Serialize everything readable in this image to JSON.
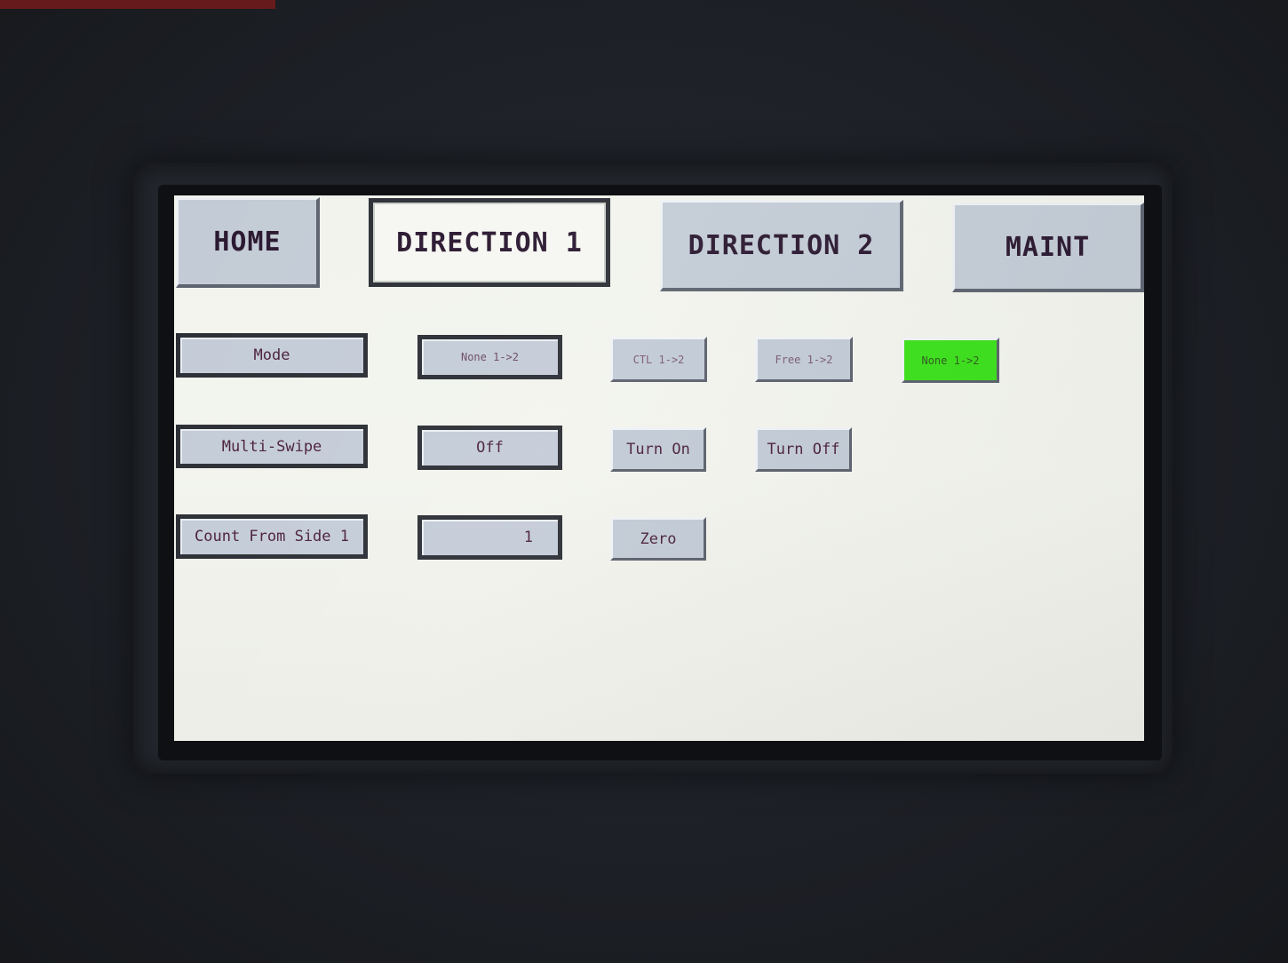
{
  "tabs": {
    "home": "HOME",
    "direction1": "DIRECTION 1",
    "direction2": "DIRECTION 2",
    "maint": "MAINT"
  },
  "rows": {
    "mode": {
      "label": "Mode",
      "value": "None 1->2",
      "options": {
        "ctl": "CTL 1->2",
        "free": "Free 1->2",
        "none": "None 1->2"
      },
      "active_color": "#3be01a"
    },
    "multi_swipe": {
      "label": "Multi-Swipe",
      "value": "Off",
      "turn_on": "Turn On",
      "turn_off": "Turn Off"
    },
    "count": {
      "label": "Count From Side 1",
      "value": "1",
      "zero": "Zero"
    }
  }
}
